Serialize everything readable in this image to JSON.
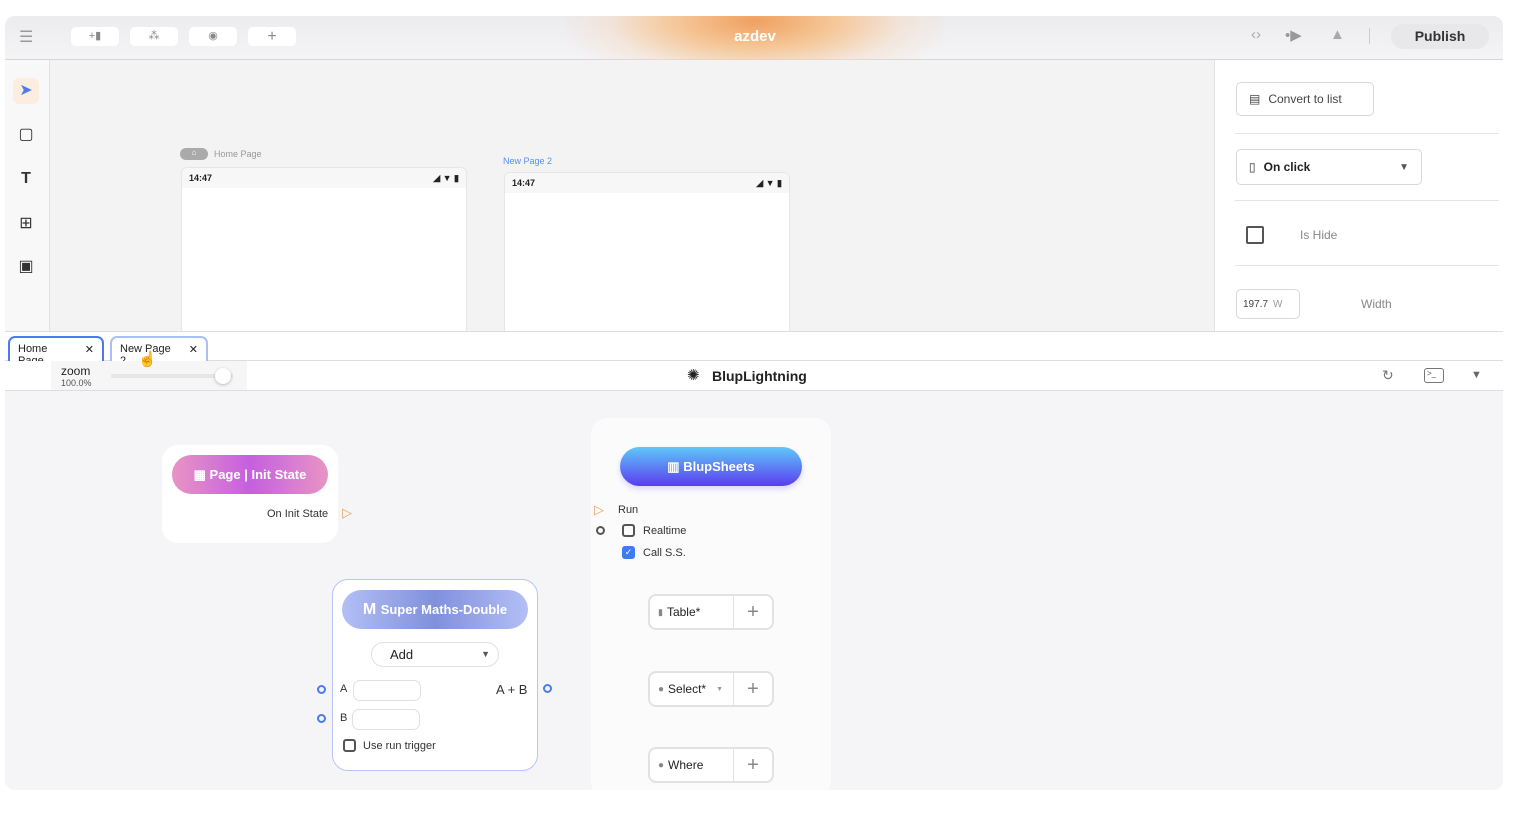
{
  "topbar": {
    "brand": "azdev",
    "publish": "Publish",
    "tool_icons": [
      "add-component-icon",
      "tree-icon",
      "preview-icon",
      "plus-icon"
    ]
  },
  "left_tools": [
    "pointer-icon",
    "rectangle-icon",
    "text-icon",
    "layout-icon",
    "save-icon"
  ],
  "canvas": {
    "pages": [
      {
        "label": "Home Page",
        "time": "14:47"
      },
      {
        "label": "New Page 2",
        "time": "14:47"
      }
    ]
  },
  "right_panel": {
    "convert_to_list": "Convert to list",
    "event_select": "On click",
    "is_hide": "Is Hide",
    "width_value": "197.7",
    "width_unit": "W",
    "width_label": "Width"
  },
  "tabs": [
    {
      "label": "Home Page"
    },
    {
      "label": "New Page 2"
    }
  ],
  "toolbar2": {
    "zoom_label": "zoom",
    "zoom_value": "100.0%",
    "zoom_level": 1.0,
    "title": "BlupLightning"
  },
  "nodes": {
    "init": {
      "title": "Page | Init State",
      "output": "On Init State"
    },
    "maths": {
      "title": "Super Maths-Double",
      "operation": "Add",
      "input_a": "A",
      "input_b": "B",
      "output": "A + B",
      "run_trigger": "Use run trigger"
    },
    "sheets": {
      "title": "BlupSheets",
      "run": "Run",
      "realtime": "Realtime",
      "call_ss": "Call S.S.",
      "table": "Table*",
      "select": "Select*",
      "where": "Where"
    }
  },
  "colors": {
    "accent": "#4a7cf0",
    "port_orange": "#f0a060"
  }
}
